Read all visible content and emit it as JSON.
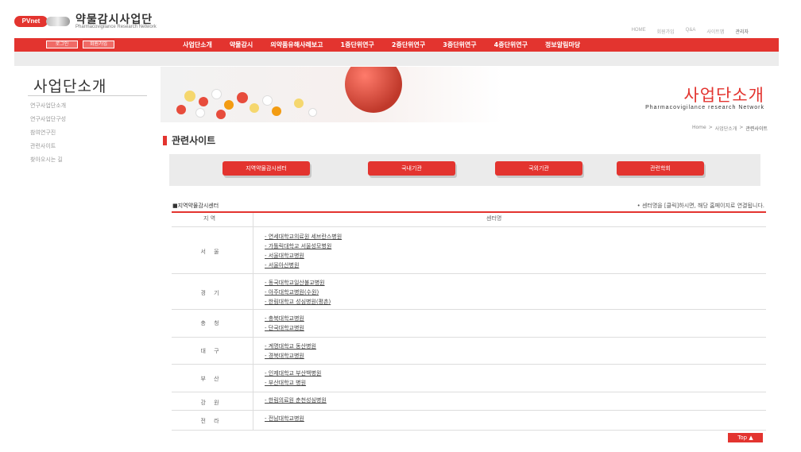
{
  "header": {
    "logo_badge": "PVnet",
    "logo_title": "약물감시사업단",
    "logo_subtitle": "Pharmacovigilance Research Network",
    "util_links": [
      "HOME",
      "회원가입",
      "Q&A",
      "사이트맵",
      "관리자"
    ]
  },
  "gnb": {
    "buttons": [
      "로그인",
      "회원가입"
    ],
    "menu": [
      "사업단소개",
      "약물감시",
      "의약품유해사례보고",
      "1중단위연구",
      "2중단위연구",
      "3중단위연구",
      "4중단위연구",
      "정보알림마당"
    ]
  },
  "lnb": {
    "title": "사업단소개",
    "items": [
      "연구사업단소개",
      "연구사업단구성",
      "참여연구진",
      "관련사이트",
      "찾아오시는 길"
    ]
  },
  "visual": {
    "title": "사업단소개",
    "subtitle": "Pharmacovigilance research Network"
  },
  "breadcrumb": [
    "Home",
    ">",
    "사업단소개",
    ">",
    "관련사이트"
  ],
  "page_title": "관련사이트",
  "tabs": [
    "지역약물감시센터",
    "국내기관",
    "국외기관",
    "관련학회"
  ],
  "section": {
    "title": "■지역약물감시센터",
    "note": "• 센터명을 [클릭]하시면, 해당 홈페이지로 연결됩니다."
  },
  "table": {
    "headers": [
      "지 역",
      "센터명"
    ],
    "rows": [
      {
        "region": "서 울",
        "hospitals": [
          "- 연세대학교의료원 세브란스병원",
          "- 가톨릭대학교 서울성모병원",
          "- 서울대학교병원",
          "- 서울아산병원"
        ]
      },
      {
        "region": "경 기",
        "hospitals": [
          "- 동국대학교일산불교병원",
          "- 아주대학교병원(수원)",
          "- 한림대학교 성심병원(평촌)"
        ]
      },
      {
        "region": "충 청",
        "hospitals": [
          "- 충북대학교병원",
          "- 단국대학교병원"
        ]
      },
      {
        "region": "대 구",
        "hospitals": [
          "- 계명대학교 동산병원",
          "- 경북대학교병원"
        ]
      },
      {
        "region": "부 산",
        "hospitals": [
          "- 인제대학교 부산백병원",
          "- 부산대학교 병원"
        ]
      },
      {
        "region": "강 원",
        "hospitals": [
          "- 한림의료원 춘천성심병원"
        ]
      },
      {
        "region": "전 라",
        "hospitals": [
          "- 전남대학교병원"
        ]
      }
    ]
  },
  "top_button": "Top ▲",
  "colors": {
    "accent": "#e3342f",
    "tab_box": "#ebebeb",
    "subbar": "#ececec"
  }
}
